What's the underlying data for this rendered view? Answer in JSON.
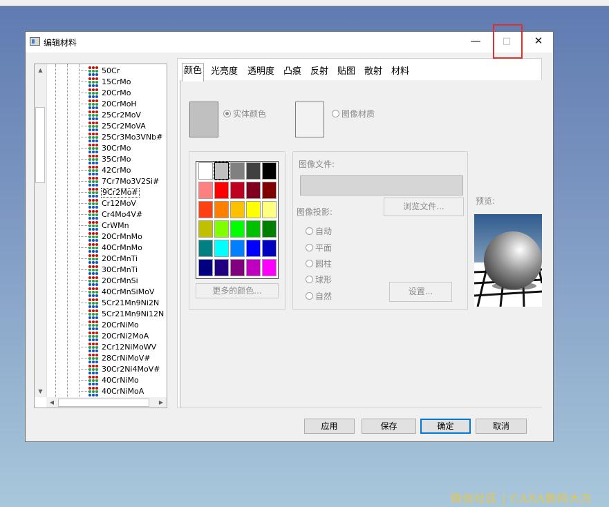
{
  "window": {
    "title": "编辑材料",
    "minimize_glyph": "—",
    "maximize_glyph": "□",
    "close_glyph": "✕"
  },
  "tree": {
    "items": [
      "50Cr",
      "15CrMo",
      "20CrMo",
      "20CrMoH",
      "25Cr2MoV",
      "25Cr2MoVA",
      "25Cr3Mo3VNb#",
      "30CrMo",
      "35CrMo",
      "42CrMo",
      "7Cr7Mo3V2Si#",
      "9Cr2Mo#",
      "Cr12MoV",
      "Cr4Mo4V#",
      "CrWMn",
      "20CrMnMo",
      "40CrMnMo",
      "20CrMnTi",
      "30CrMnTi",
      "20CrMnSi",
      "40CrMnSiMoV",
      "5Cr21Mn9Ni2N",
      "5Cr21Mn9Ni12N",
      "20CrNiMo",
      "20CrNi2MoA",
      "2Cr12NiMoWV",
      "28CrNiMoV#",
      "30Cr2Ni4MoV#",
      "40CrNiMo",
      "40CrNiMoA"
    ],
    "selected_index": 11
  },
  "tabs": [
    "颜色",
    "光亮度",
    "透明度",
    "凸痕",
    "反射",
    "贴图",
    "散射",
    "材料"
  ],
  "active_tab": 0,
  "color_tab": {
    "solid_color_label": "实体颜色",
    "image_material_label": "图像材质",
    "solid_swatch_color": "#c0c0c0",
    "image_swatch_color": "#f2f2f2",
    "palette": [
      [
        "#ffffff",
        "#c0c0c0",
        "#808080",
        "#404040",
        "#000000"
      ],
      [
        "#ff8080",
        "#ff0000",
        "#c00020",
        "#800020",
        "#800000"
      ],
      [
        "#ff4010",
        "#ff8000",
        "#ffc000",
        "#ffff00",
        "#ffff80"
      ],
      [
        "#c0c000",
        "#80ff00",
        "#00ff00",
        "#00c000",
        "#008000"
      ],
      [
        "#008080",
        "#00ffff",
        "#0080ff",
        "#0000ff",
        "#0000c0"
      ],
      [
        "#000080",
        "#200080",
        "#800080",
        "#c000c0",
        "#ff00ff"
      ]
    ],
    "selected_palette_cell": [
      0,
      1
    ],
    "more_colors_button": "更多的颜色...",
    "image_file_label": "图像文件:",
    "browse_button": "浏览文件...",
    "projection_label": "图像投影:",
    "projections": [
      "自动",
      "平面",
      "圆柱",
      "球形",
      "自然"
    ],
    "settings_button": "设置...",
    "preview_label": "预览:"
  },
  "buttons": {
    "apply": "应用",
    "save": "保存",
    "ok": "确定",
    "cancel": "取消"
  },
  "watermark": "微信社区 | CAXA数码大方"
}
